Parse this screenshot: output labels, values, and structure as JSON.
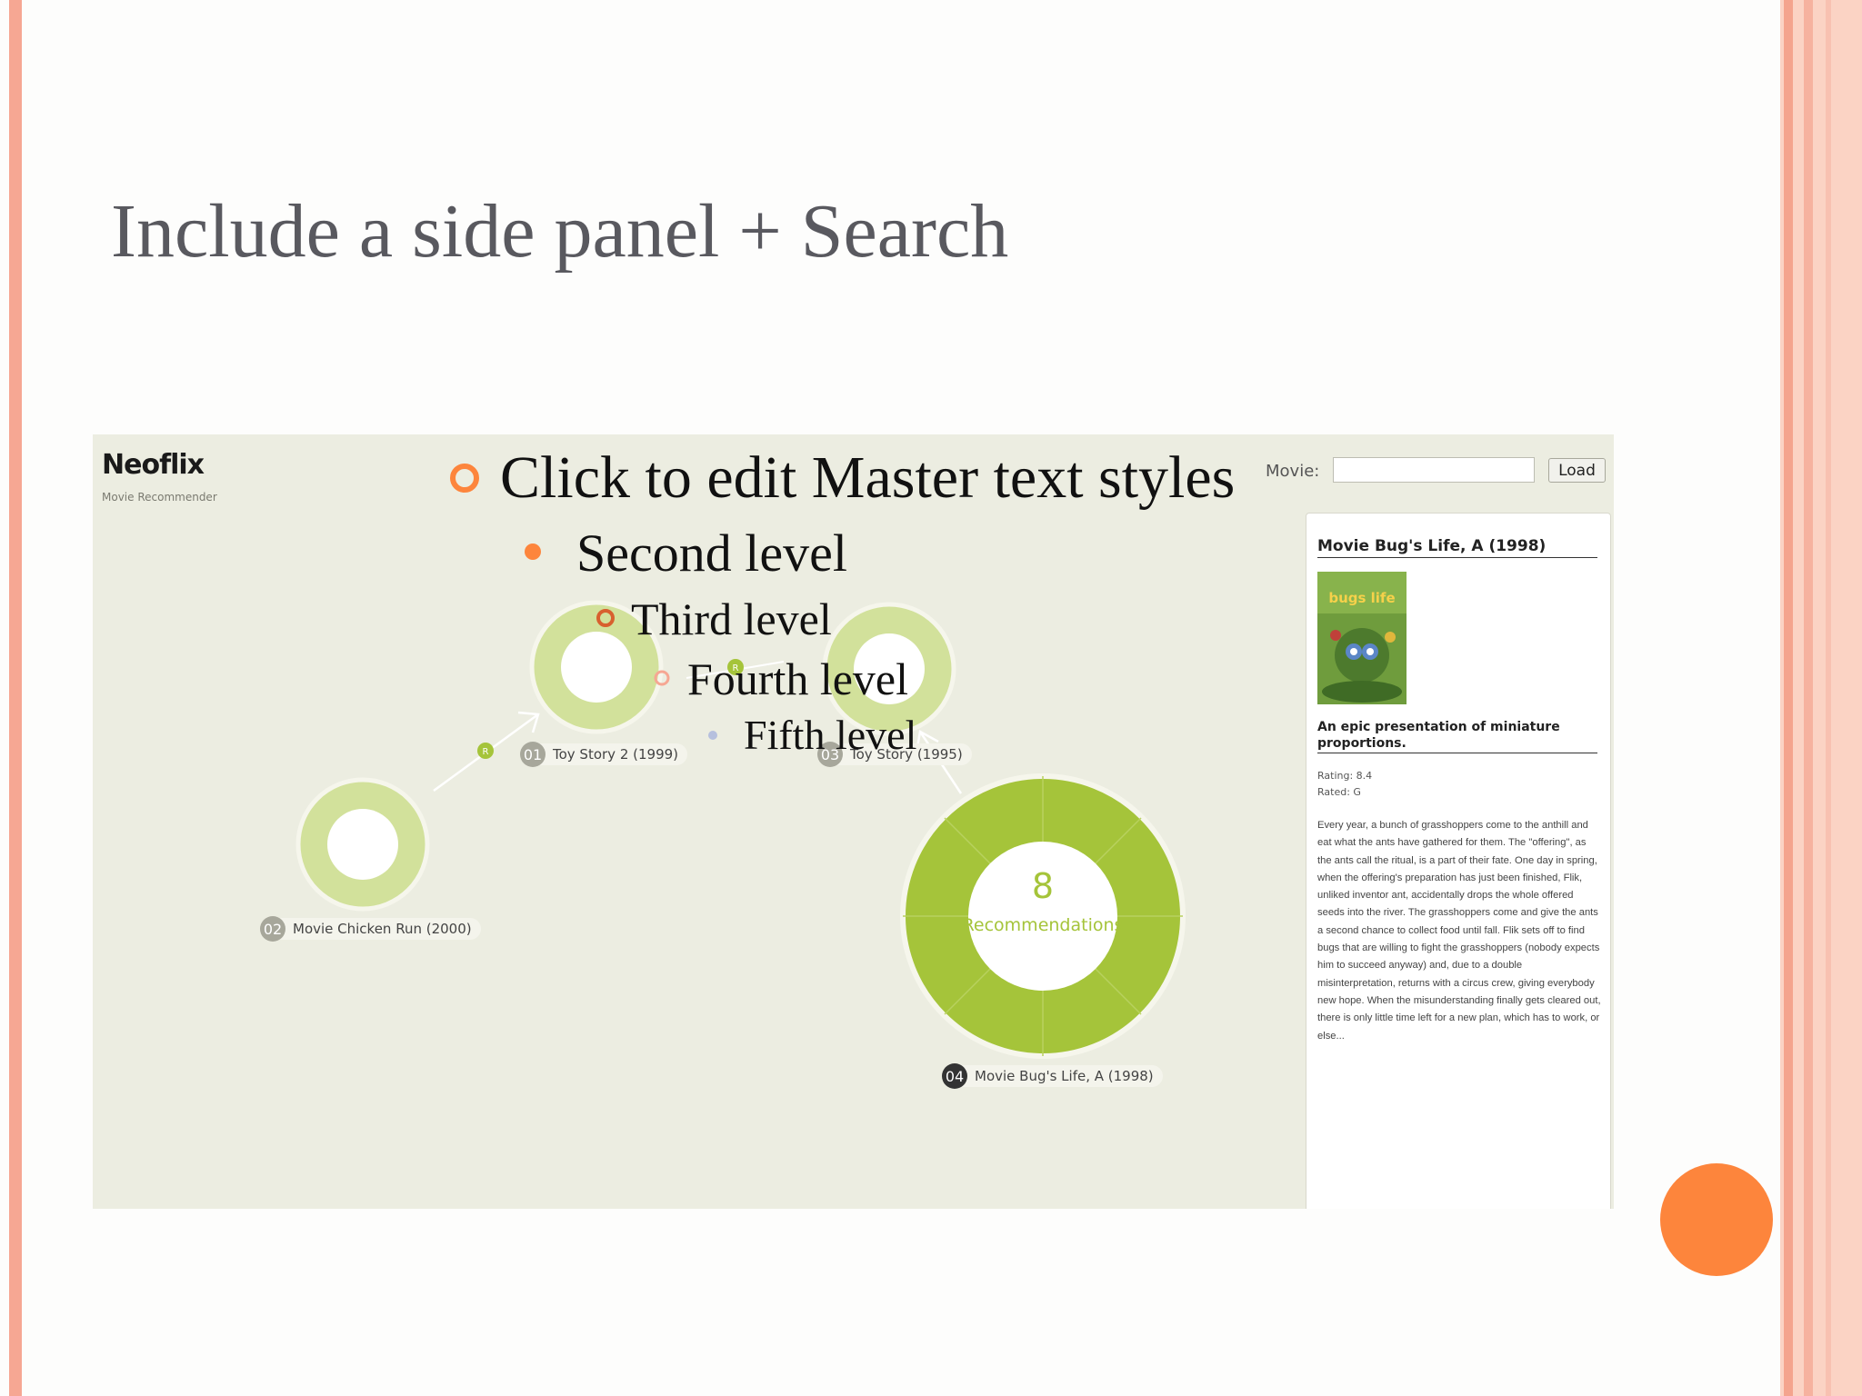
{
  "slide": {
    "title": "Include a side panel + Search",
    "master_text": {
      "level1": "Click to edit Master text styles",
      "level2": "Second level",
      "level3": "Third level",
      "level4": "Fourth level",
      "level5": "Fifth level"
    },
    "colors": {
      "accent": "#fd853c",
      "stripe": "#f6a793"
    }
  },
  "app": {
    "brand": "Neoflix",
    "subtitle": "Movie Recommender",
    "search": {
      "label": "Movie:",
      "value": "",
      "placeholder": ""
    },
    "load_label": "Load",
    "graph": {
      "nodes": [
        {
          "number": "01",
          "label": "Toy Story 2 (1999)"
        },
        {
          "number": "02",
          "label": "Movie Chicken Run (2000)"
        },
        {
          "number": "03",
          "label": "Toy Story (1995)"
        },
        {
          "number": "04",
          "label": "Movie Bug's Life, A (1998)"
        }
      ],
      "edge_marker": "R",
      "center_count": "8",
      "center_label": "Recommendations",
      "colors": {
        "ring_light": "#d2e19b",
        "ring_main": "#a5c43a"
      }
    },
    "panel": {
      "title": "Movie Bug's Life, A (1998)",
      "poster_title": "bugs life",
      "tagline": "An epic presentation of miniature proportions.",
      "rating": "Rating: 8.4",
      "rated": "Rated: G",
      "description": "Every year, a bunch of grasshoppers come to the anthill and eat what the ants have gathered for them. The \"offering\", as the ants call the ritual, is a part of their fate. One day in spring, when the offering's preparation has just been finished, Flik, unliked inventor ant, accidentally drops the whole offered seeds into the river. The grasshoppers come and give the ants a second chance to collect food until fall. Flik sets off to find bugs that are willing to fight the grasshoppers (nobody expects him to succeed anyway) and, due to a double misinterpretation, returns with a circus crew, giving everybody new hope. When the misunderstanding finally gets cleared out, there is only little time left for a new plan, which has to work, or else..."
    }
  }
}
